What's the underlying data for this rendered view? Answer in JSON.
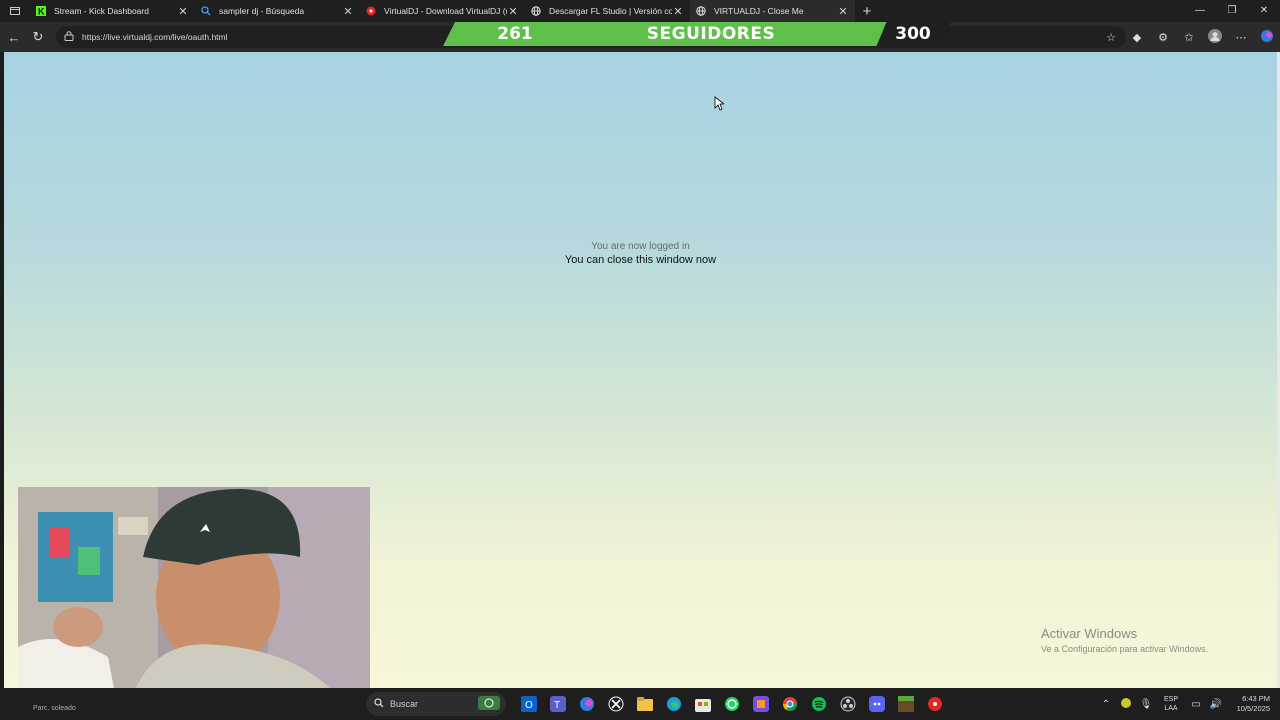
{
  "browser": {
    "tabs": [
      {
        "title": "Stream - Kick Dashboard",
        "favicon": "kick-icon",
        "active": false
      },
      {
        "title": "sampler dj - Búsqueda",
        "favicon": "search-icon",
        "active": false
      },
      {
        "title": "VirtualDJ - Download VirtualDJ (u",
        "favicon": "record-icon",
        "active": false
      },
      {
        "title": "Descargar FL Studio | Versión com",
        "favicon": "globe-icon",
        "active": false
      },
      {
        "title": "VIRTUALDJ - Close Me",
        "favicon": "globe-icon",
        "active": true
      }
    ],
    "url": "https://live.virtualdj.com/live/oauth.html"
  },
  "overlay": {
    "current_followers": "261",
    "label": "SEGUIDORES",
    "goal": "300",
    "current_value": 261,
    "goal_value": 300
  },
  "page": {
    "line1": "You are now logged in",
    "line2": "You can close this window now"
  },
  "watermark": {
    "title": "Activar Windows",
    "subtitle": "Ve a Configuración para activar Windows."
  },
  "taskbar": {
    "weather": "Parc. soleado",
    "search_placeholder": "Buscar",
    "lang_top": "ESP",
    "lang_bottom": "LAA",
    "time": "6:43 PM",
    "date": "10/5/2025"
  },
  "colors": {
    "overlay_green": "#5ec04a",
    "overlay_dark": "#1f1f1f",
    "page_top": "#a7d2e2",
    "page_bottom": "#f8f6d9"
  }
}
